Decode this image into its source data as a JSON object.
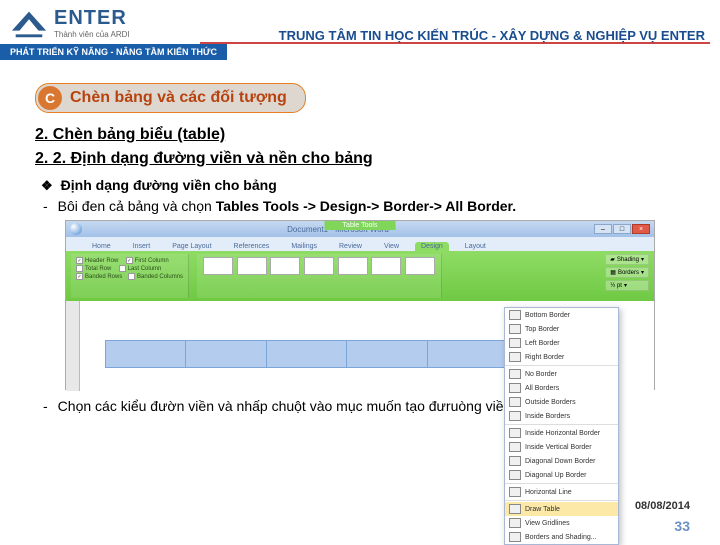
{
  "header": {
    "logo_main": "ENTER",
    "logo_sub": "Thành viên của ARDI",
    "banner": "TRUNG TÂM TIN HỌC KIẾN TRÚC - XÂY DỰNG & NGHIỆP VỤ ENTER",
    "strip": "PHÁT TRIỂN KỸ NĂNG - NÂNG TẦM KIẾN THỨC"
  },
  "section": {
    "letter": "C",
    "title": "Chèn bảng và các đối tượng"
  },
  "headings": {
    "h1": "2. Chèn bảng biểu (table)",
    "h2": "2. 2. Định dạng đường viền và nền cho bảng"
  },
  "bullets": {
    "b1": "Định dạng đường viền cho bảng",
    "dash1_pre": "Bôi đen cả bảng và chọn ",
    "dash1_bold": "Tables Tools -> Design-> Border-> All Border.",
    "dash2": "Chọn các kiểu đườn viền và nhấp chuột vào mục muốn tạo đưruòng viền."
  },
  "word": {
    "title": "Document1 - Microsoft Word",
    "table_tools": "Table Tools",
    "tabs": [
      "Home",
      "Insert",
      "Page Layout",
      "References",
      "Mailings",
      "Review",
      "View",
      "Design",
      "Layout"
    ],
    "checks": {
      "header_row": "Header Row",
      "first_col": "First Column",
      "total_row": "Total Row",
      "last_col": "Last Column",
      "banded_rows": "Banded Rows",
      "banded_cols": "Banded Columns"
    },
    "shading": "Shading",
    "borders": "Borders",
    "pen": "½ pt",
    "menu": {
      "bottom": "Bottom Border",
      "top": "Top Border",
      "left": "Left Border",
      "right": "Right Border",
      "none": "No Border",
      "all": "All Borders",
      "outside": "Outside Borders",
      "inside": "Inside Borders",
      "ih": "Inside Horizontal Border",
      "iv": "Inside Vertical Border",
      "dd": "Diagonal Down Border",
      "du": "Diagonal Up Border",
      "hl": "Horizontal Line",
      "draw": "Draw Table",
      "grid": "View Gridlines",
      "bs": "Borders and Shading..."
    }
  },
  "footer": {
    "date": "08/08/2014",
    "page": "33"
  }
}
